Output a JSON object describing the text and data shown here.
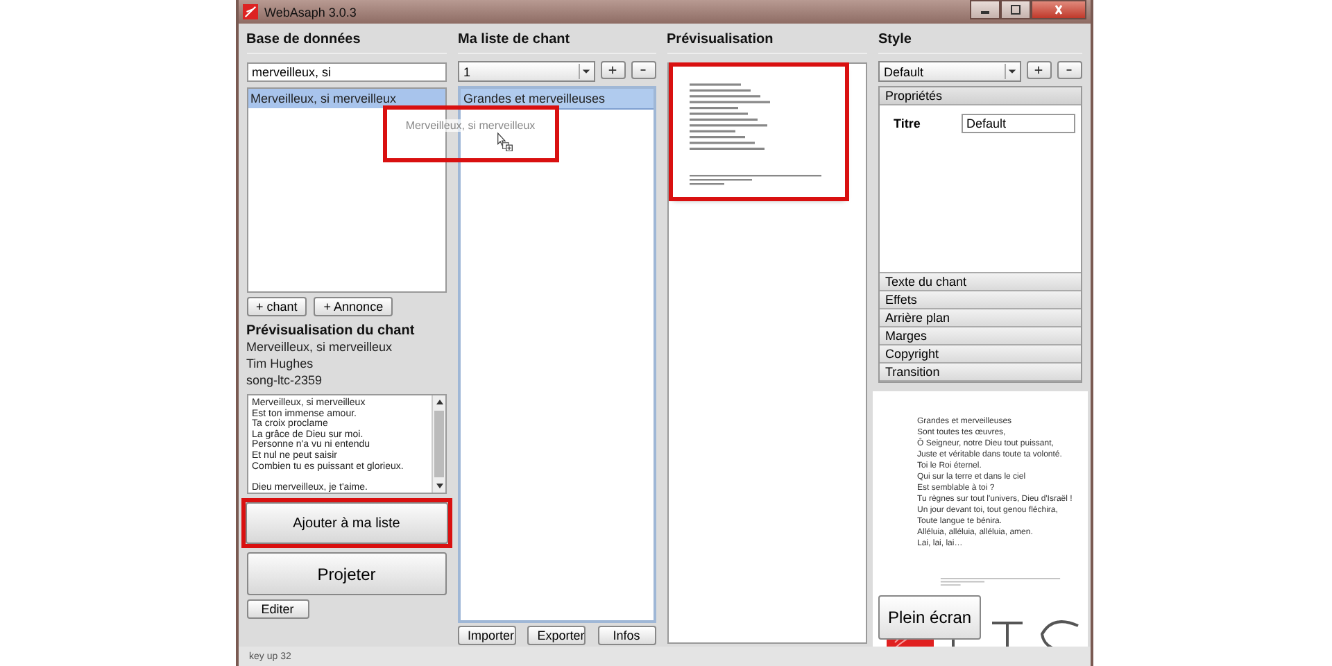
{
  "window": {
    "title": "WebAsaph 3.0.3"
  },
  "database": {
    "heading": "Base de données",
    "search": "merveilleux, si",
    "results": [
      {
        "label": "Merveilleux, si merveilleux",
        "selected": true
      }
    ],
    "buttons": [
      "+ chant",
      "+ Annonce"
    ],
    "song_preview": {
      "heading": "Prévisualisation du chant",
      "title": "Merveilleux, si merveilleux",
      "author": "Tim Hughes",
      "id": "song-ltc-2359",
      "lyrics": [
        [
          "Merveilleux, si merveilleux",
          "Est ton immense amour.",
          "Ta croix proclame",
          "La grâce de Dieu sur moi.",
          "Personne n'a vu ni entendu",
          "Et nul ne peut saisir",
          "Combien tu es puissant et glorieux."
        ],
        [
          "Dieu merveilleux, je t'aime."
        ]
      ]
    },
    "add_button": {
      "label": "Ajouter à ma liste",
      "highlighted": true
    },
    "project_button": "Projeter",
    "edit_button": "Editer"
  },
  "drag_ghost": {
    "label": "Merveilleux, si merveilleux",
    "highlighted": true
  },
  "my_list": {
    "heading": "Ma liste de chant",
    "list_selector": "1",
    "items": [
      {
        "label": "Grandes et merveilleuses",
        "selected": true
      }
    ],
    "buttons": [
      "Importer",
      "Exporter",
      "Infos"
    ]
  },
  "preview": {
    "heading": "Prévisualisation",
    "thumbnail_highlighted": true
  },
  "style": {
    "heading": "Style",
    "selector": "Default",
    "sections": [
      {
        "label": "Propriétés",
        "expanded": true
      },
      {
        "label": "Texte du chant",
        "expanded": false
      },
      {
        "label": "Effets",
        "expanded": false
      },
      {
        "label": "Arrière plan",
        "expanded": false
      },
      {
        "label": "Marges",
        "expanded": false
      },
      {
        "label": "Copyright",
        "expanded": false
      },
      {
        "label": "Transition",
        "expanded": false
      }
    ],
    "properties": [
      {
        "label": "Titre",
        "value": "Default"
      }
    ],
    "slide_lines": [
      "Grandes et merveilleuses",
      "Sont toutes tes œuvres,",
      "Ô Seigneur, notre Dieu tout puissant,",
      "Juste et véritable dans toute ta volonté.",
      "Toi le Roi éternel.",
      "Qui sur la terre et dans le ciel",
      "Est semblable à toi ?",
      "Tu règnes sur tout l'univers, Dieu d'Israël !",
      "Un jour devant toi, tout genou fléchira,",
      "Toute langue te bénira.",
      "Alléluia, alléluia, alléluia, amen.",
      "Lai, lai, lai…"
    ],
    "fullscreen_button": "Plein écran"
  },
  "status_bar": "key up 32"
}
